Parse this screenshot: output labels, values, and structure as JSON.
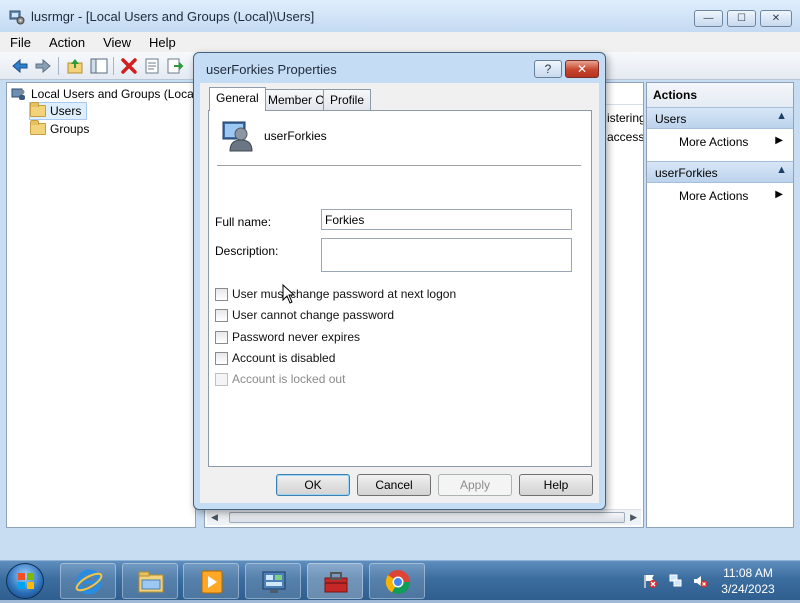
{
  "window": {
    "title": "lusrmgr - [Local Users and Groups (Local)\\Users]",
    "minimize_glyph": "—",
    "maximize_glyph": "☐",
    "close_glyph": "✕"
  },
  "menu": [
    "File",
    "Action",
    "View",
    "Help"
  ],
  "toolbar_icons": [
    "back-arrow-icon",
    "forward-arrow-icon",
    "up-folder-icon",
    "show-hide-tree-icon",
    "delete-icon",
    "properties-icon",
    "export-list-icon"
  ],
  "tree": {
    "root": "Local Users and Groups (Local)",
    "items": [
      "Users",
      "Groups"
    ],
    "selected": "Users"
  },
  "list_fragments": [
    "istering",
    "access t"
  ],
  "actions": {
    "title": "Actions",
    "sections": [
      {
        "header": "Users",
        "items": [
          "More Actions"
        ]
      },
      {
        "header": "userForkies",
        "items": [
          "More Actions"
        ]
      }
    ]
  },
  "dialog": {
    "title": "userForkies Properties",
    "help_glyph": "?",
    "close_glyph": "✕",
    "tabs": [
      "General",
      "Member Of",
      "Profile"
    ],
    "active_tab": "General",
    "username": "userForkies",
    "fullname_label": "Full name:",
    "fullname_value": "Forkies",
    "description_label": "Description:",
    "description_value": "",
    "checkboxes": [
      {
        "label": "User must change password at next logon",
        "checked": false,
        "enabled": true
      },
      {
        "label": "User cannot change password",
        "checked": false,
        "enabled": true
      },
      {
        "label": "Password never expires",
        "checked": false,
        "enabled": true
      },
      {
        "label": "Account is disabled",
        "checked": false,
        "enabled": true
      },
      {
        "label": "Account is locked out",
        "checked": false,
        "enabled": false
      }
    ],
    "buttons": {
      "ok": "OK",
      "cancel": "Cancel",
      "apply": "Apply",
      "help": "Help"
    }
  },
  "taskbar": {
    "apps": [
      "internet-explorer",
      "file-explorer",
      "media-player",
      "control-panel",
      "toolbox",
      "chrome"
    ],
    "time": "11:08 AM",
    "date": "3/24/2023"
  }
}
